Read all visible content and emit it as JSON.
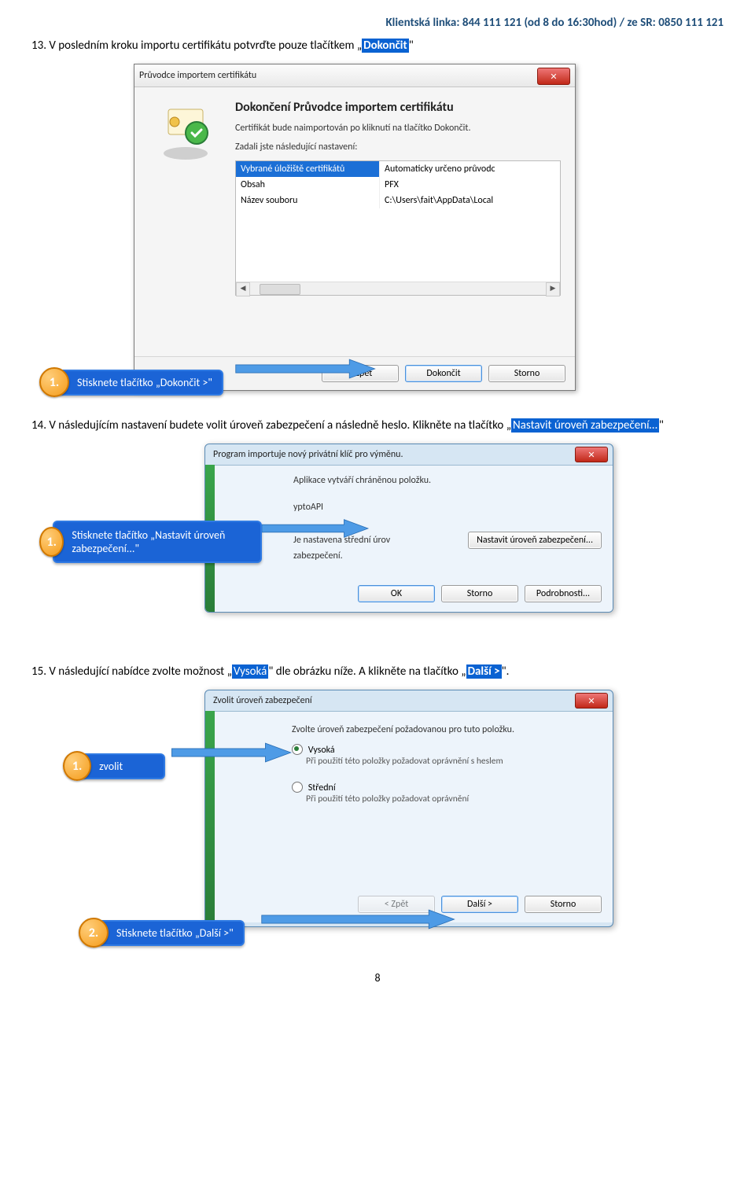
{
  "header": "Klientská linka: 844 111 121 (od 8 do 16:30hod) / ze SR: 0850 111 121",
  "step13": {
    "prefix": "13. V posledním kroku importu certifikátu potvrďte pouze tlačítkem „",
    "hl": "Dokončit",
    "suffix": "\""
  },
  "wizard": {
    "title": "Průvodce importem certifikátu",
    "heading": "Dokončení Průvodce importem certifikátu",
    "body1": "Certifikát bude naimportován po kliknutí na tlačítko Dokončit.",
    "body2": "Zadali jste následující nastavení:",
    "rows": [
      {
        "a": "Vybrané úložiště certifikátů",
        "b": "Automaticky určeno průvodc"
      },
      {
        "a": "Obsah",
        "b": "PFX"
      },
      {
        "a": "Název souboru",
        "b": "C:\\Users\\fait\\AppData\\Local"
      }
    ],
    "buttons": {
      "back": "< Zpět",
      "finish": "Dokončit",
      "cancel": "Storno"
    }
  },
  "callout1": {
    "num": "1.",
    "text": "Stisknete tlačítko „Dokončit >\""
  },
  "step14": {
    "prefix": "14. V následujícím nastavení budete volit úroveň zabezpečení a následně heslo. Klikněte na tlačítko „",
    "hl": "Nastavit úroveň zabezpečení…",
    "suffix": "\""
  },
  "importKey": {
    "title": "Program importuje nový privátní klíč pro výměnu.",
    "line1": "Aplikace vytváří chráněnou položku.",
    "row1_k": "",
    "row1_v": "yptoAPI",
    "row2_k": "Je nastavena střední úrov",
    "row2_v_suffix": "eň zabezpečení.",
    "btnSet": "Nastavit úroveň zabezpečení...",
    "ok": "OK",
    "storno": "Storno",
    "details": "Podrobnosti..."
  },
  "callout2": {
    "num": "1.",
    "text": "Stisknete tlačítko „Nastavit úroveň zabezpečení...\""
  },
  "step15": {
    "prefix": "15. V následující nabídce zvolte možnost „",
    "hl1": "Vysoká",
    "mid": "\" dle obrázku níže. A klikněte na tlačítko „",
    "hl2": "Další >",
    "suffix": "\"."
  },
  "secLevel": {
    "title": "Zvolit úroveň zabezpečení",
    "intro": "Zvolte úroveň zabezpečení požadovanou pro tuto položku.",
    "optHigh": "Vysoká",
    "optHighSub": "Při použití této položky požadovat oprávnění s heslem",
    "optMid": "Střední",
    "optMidSub": "Při použití této položky požadovat oprávnění",
    "back": "< Zpět",
    "next": "Další >",
    "cancel": "Storno"
  },
  "callout3": {
    "num": "1.",
    "text": "zvolit"
  },
  "callout4": {
    "num": "2.",
    "text": "Stisknete tlačítko „Další >\""
  },
  "pageNum": "8"
}
